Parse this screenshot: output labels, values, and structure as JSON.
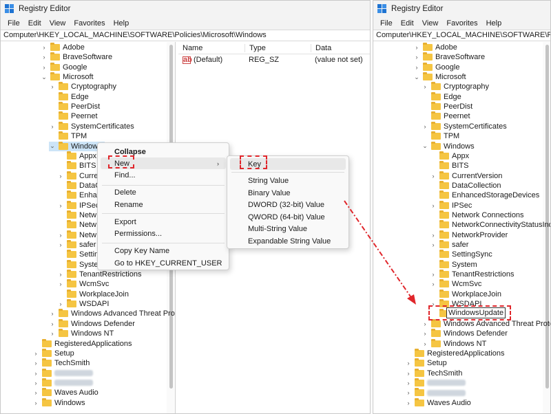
{
  "left_window": {
    "title": "Registry Editor",
    "menu": [
      "File",
      "Edit",
      "View",
      "Favorites",
      "Help"
    ],
    "address": "Computer\\HKEY_LOCAL_MACHINE\\SOFTWARE\\Policies\\Microsoft\\Windows",
    "tree": [
      {
        "label": "Adobe",
        "chev": "›"
      },
      {
        "label": "BraveSoftware",
        "chev": "›"
      },
      {
        "label": "Google",
        "chev": "›"
      },
      {
        "label": "Microsoft",
        "chev": "⌄"
      },
      {
        "label": "Cryptography",
        "chev": "›"
      },
      {
        "label": "Edge",
        "chev": ""
      },
      {
        "label": "PeerDist",
        "chev": ""
      },
      {
        "label": "Peernet",
        "chev": ""
      },
      {
        "label": "SystemCertificates",
        "chev": "›"
      },
      {
        "label": "TPM",
        "chev": ""
      },
      {
        "label": "Windows",
        "chev": "⌄"
      },
      {
        "label": "Appx",
        "chev": ""
      },
      {
        "label": "BITS",
        "chev": ""
      },
      {
        "label": "Curre",
        "chev": "›"
      },
      {
        "label": "DataC",
        "chev": ""
      },
      {
        "label": "Enhan",
        "chev": ""
      },
      {
        "label": "IPSec",
        "chev": "›"
      },
      {
        "label": "Netw",
        "chev": ""
      },
      {
        "label": "Netw",
        "chev": ""
      },
      {
        "label": "Netw",
        "chev": "›"
      },
      {
        "label": "safer",
        "chev": "›"
      },
      {
        "label": "Settin",
        "chev": ""
      },
      {
        "label": "Syster",
        "chev": ""
      },
      {
        "label": "TenantRestrictions",
        "chev": "›"
      },
      {
        "label": "WcmSvc",
        "chev": "›"
      },
      {
        "label": "WorkplaceJoin",
        "chev": ""
      },
      {
        "label": "WSDAPI",
        "chev": "›"
      },
      {
        "label": "Windows Advanced Threat Protec",
        "chev": "›"
      },
      {
        "label": "Windows Defender",
        "chev": "›"
      },
      {
        "label": "Windows NT",
        "chev": "›"
      },
      {
        "label": "RegisteredApplications",
        "chev": ""
      },
      {
        "label": "Setup",
        "chev": "›"
      },
      {
        "label": "TechSmith",
        "chev": "›"
      },
      {
        "label": "",
        "chev": "›"
      },
      {
        "label": "",
        "chev": "›"
      },
      {
        "label": "Waves Audio",
        "chev": "›"
      },
      {
        "label": "Windows",
        "chev": "›"
      }
    ],
    "columns": {
      "name": "Name",
      "type": "Type",
      "data": "Data"
    },
    "value_row": {
      "icon_text": "ab",
      "name": "(Default)",
      "type": "REG_SZ",
      "data": "(value not set)"
    },
    "context_menu": {
      "collapse": "Collapse",
      "new": "New",
      "find": "Find...",
      "delete": "Delete",
      "rename": "Rename",
      "export": "Export",
      "permissions": "Permissions...",
      "copy_key_name": "Copy Key Name",
      "goto_hkcu": "Go to HKEY_CURRENT_USER",
      "submenu_arrow": "›"
    },
    "sub_menu": {
      "key": "Key",
      "string_value": "String Value",
      "binary_value": "Binary Value",
      "dword": "DWORD (32-bit) Value",
      "qword": "QWORD (64-bit) Value",
      "multi_string": "Multi-String Value",
      "expandable_string": "Expandable String Value"
    }
  },
  "right_window": {
    "title": "Registry Editor",
    "menu": [
      "File",
      "Edit",
      "View",
      "Favorites",
      "Help"
    ],
    "address": "Computer\\HKEY_LOCAL_MACHINE\\SOFTWARE\\Policies\\Microsoft\\Windows",
    "tree": [
      {
        "label": "Adobe",
        "chev": "›"
      },
      {
        "label": "BraveSoftware",
        "chev": "›"
      },
      {
        "label": "Google",
        "chev": "›"
      },
      {
        "label": "Microsoft",
        "chev": "⌄"
      },
      {
        "label": "Cryptography",
        "chev": "›"
      },
      {
        "label": "Edge",
        "chev": ""
      },
      {
        "label": "PeerDist",
        "chev": ""
      },
      {
        "label": "Peernet",
        "chev": ""
      },
      {
        "label": "SystemCertificates",
        "chev": "›"
      },
      {
        "label": "TPM",
        "chev": ""
      },
      {
        "label": "Windows",
        "chev": "⌄"
      },
      {
        "label": "Appx",
        "chev": ""
      },
      {
        "label": "BITS",
        "chev": ""
      },
      {
        "label": "CurrentVersion",
        "chev": "›"
      },
      {
        "label": "DataCollection",
        "chev": ""
      },
      {
        "label": "EnhancedStorageDevices",
        "chev": ""
      },
      {
        "label": "IPSec",
        "chev": "›"
      },
      {
        "label": "Network Connections",
        "chev": ""
      },
      {
        "label": "NetworkConnectivityStatusInd",
        "chev": ""
      },
      {
        "label": "NetworkProvider",
        "chev": "›"
      },
      {
        "label": "safer",
        "chev": "›"
      },
      {
        "label": "SettingSync",
        "chev": ""
      },
      {
        "label": "System",
        "chev": ""
      },
      {
        "label": "TenantRestrictions",
        "chev": "›"
      },
      {
        "label": "WcmSvc",
        "chev": "›"
      },
      {
        "label": "WorkplaceJoin",
        "chev": ""
      },
      {
        "label": "WSDAPI",
        "chev": "›"
      },
      {
        "label": "WindowsUpdate",
        "chev": ""
      },
      {
        "label": "Windows Advanced Threat Protec",
        "chev": "›"
      },
      {
        "label": "Windows Defender",
        "chev": "›"
      },
      {
        "label": "Windows NT",
        "chev": "›"
      },
      {
        "label": "RegisteredApplications",
        "chev": ""
      },
      {
        "label": "Setup",
        "chev": "›"
      },
      {
        "label": "TechSmith",
        "chev": "›"
      },
      {
        "label": "",
        "chev": "›"
      },
      {
        "label": "",
        "chev": "›"
      },
      {
        "label": "Waves Audio",
        "chev": "›"
      }
    ],
    "rename_value": "WindowsUpdate"
  },
  "colors": {
    "highlight": "#e0262b",
    "folder": "#f5c542",
    "selection": "#cce4f7"
  }
}
